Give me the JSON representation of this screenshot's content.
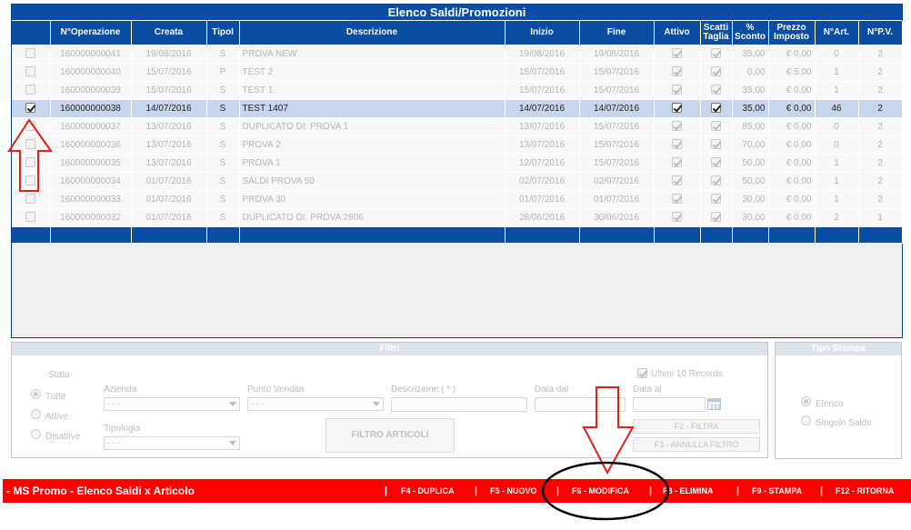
{
  "grid": {
    "title": "Elenco Saldi/Promozioni",
    "columns": [
      "",
      "N°Operazione",
      "Creata",
      "TipoI",
      "Descrizione",
      "Inizio",
      "Fine",
      "Attivo",
      "Scatti Taglia",
      "% Sconto",
      "Prezzo Imposto",
      "N°Art.",
      "N°P.V."
    ],
    "rows": [
      {
        "selected": false,
        "op": "160000000041",
        "creata": "19/08/2016",
        "tipo": "S",
        "desc": "PROVA NEW",
        "inizio": "19/08/2016",
        "fine": "19/08/2016",
        "attivo": true,
        "scatti": true,
        "sconto": "35,00",
        "prezzo": "€ 0,00",
        "art": "0",
        "pv": "2"
      },
      {
        "selected": false,
        "op": "160000000040",
        "creata": "15/07/2016",
        "tipo": "P",
        "desc": "TEST 2",
        "inizio": "15/07/2016",
        "fine": "15/07/2016",
        "attivo": true,
        "scatti": true,
        "sconto": "0,00",
        "prezzo": "€ 5,00",
        "art": "1",
        "pv": "2"
      },
      {
        "selected": false,
        "op": "160000000039",
        "creata": "15/07/2016",
        "tipo": "S",
        "desc": "TEST 1",
        "inizio": "15/07/2016",
        "fine": "15/07/2016",
        "attivo": true,
        "scatti": true,
        "sconto": "35,00",
        "prezzo": "€ 0,00",
        "art": "1",
        "pv": "2"
      },
      {
        "selected": true,
        "op": "160000000038",
        "creata": "14/07/2016",
        "tipo": "S",
        "desc": "TEST 1407",
        "inizio": "14/07/2016",
        "fine": "14/07/2016",
        "attivo": true,
        "scatti": true,
        "sconto": "35,00",
        "prezzo": "€ 0,00",
        "art": "46",
        "pv": "2"
      },
      {
        "selected": false,
        "op": "160000000037",
        "creata": "13/07/2016",
        "tipo": "S",
        "desc": "DUPLICATO DI: PROVA 1",
        "inizio": "13/07/2016",
        "fine": "15/07/2016",
        "attivo": true,
        "scatti": true,
        "sconto": "85,00",
        "prezzo": "€ 0,00",
        "art": "0",
        "pv": "2"
      },
      {
        "selected": false,
        "op": "160000000036",
        "creata": "13/07/2016",
        "tipo": "S",
        "desc": "PROVA 2",
        "inizio": "13/07/2016",
        "fine": "15/07/2016",
        "attivo": true,
        "scatti": true,
        "sconto": "70,00",
        "prezzo": "€ 0,00",
        "art": "0",
        "pv": "2"
      },
      {
        "selected": false,
        "op": "160000000035",
        "creata": "13/07/2016",
        "tipo": "S",
        "desc": "PROVA 1",
        "inizio": "12/07/2016",
        "fine": "15/07/2016",
        "attivo": true,
        "scatti": true,
        "sconto": "50,00",
        "prezzo": "€ 0,00",
        "art": "1",
        "pv": "2"
      },
      {
        "selected": false,
        "op": "160000000034",
        "creata": "01/07/2016",
        "tipo": "S",
        "desc": "SALDI PROVA 50",
        "inizio": "02/07/2016",
        "fine": "02/07/2016",
        "attivo": true,
        "scatti": true,
        "sconto": "50,00",
        "prezzo": "€ 0,00",
        "art": "1",
        "pv": "2"
      },
      {
        "selected": false,
        "op": "160000000033",
        "creata": "01/07/2016",
        "tipo": "S",
        "desc": "PROVA 30",
        "inizio": "01/07/2016",
        "fine": "01/07/2016",
        "attivo": true,
        "scatti": true,
        "sconto": "30,00",
        "prezzo": "€ 0,00",
        "art": "1",
        "pv": "2"
      },
      {
        "selected": false,
        "op": "160000000032",
        "creata": "01/07/2016",
        "tipo": "S",
        "desc": "DUPLICATO DI: PROVA 2806",
        "inizio": "28/06/2016",
        "fine": "30/06/2016",
        "attivo": true,
        "scatti": true,
        "sconto": "30,00",
        "prezzo": "€ 0,00",
        "art": "2",
        "pv": "1"
      }
    ]
  },
  "filters": {
    "title": "Filtri",
    "stato_label": "Stato",
    "stato_options": [
      "Tutte",
      "Attive",
      "Disattive"
    ],
    "ultimi_label": "Ultimi 10 Records",
    "azienda_label": "Azienda",
    "azienda_value": "- - -",
    "punto_vendita_label": "Punto Vendita",
    "punto_vendita_value": "- - -",
    "descrizione_label": "Descrizione ( * )",
    "data_dal_label": "Data dal",
    "data_al_label": "Data al",
    "tipologia_label": "Tipologia",
    "tipologia_value": "- - -",
    "filtro_articoli_label": "FILTRO ARTICOLI",
    "f2_label": "F2 - FILTRA",
    "f3_label": "F3 - ANNULLA FILTRO"
  },
  "tipo_stampa": {
    "title": "Tipo Stampa",
    "options": [
      "Elenco",
      "Singolo Saldo"
    ]
  },
  "bottom_bar": {
    "app_title": "- MS Promo - Elenco Saldi x Articolo",
    "separator": "|",
    "keys": [
      "F4 - DUPLICA",
      "F5 - NUOVO",
      "F6 - MODIFICA",
      "F8 - ELIMINA",
      "F9 - STAMPA",
      "F12 - RITORNA"
    ]
  },
  "colors": {
    "header_blue": "#0a4da2",
    "selected_row": "#c7d6ec",
    "bottom_bar": "#ff0000",
    "annotation_red": "#e0201a"
  }
}
